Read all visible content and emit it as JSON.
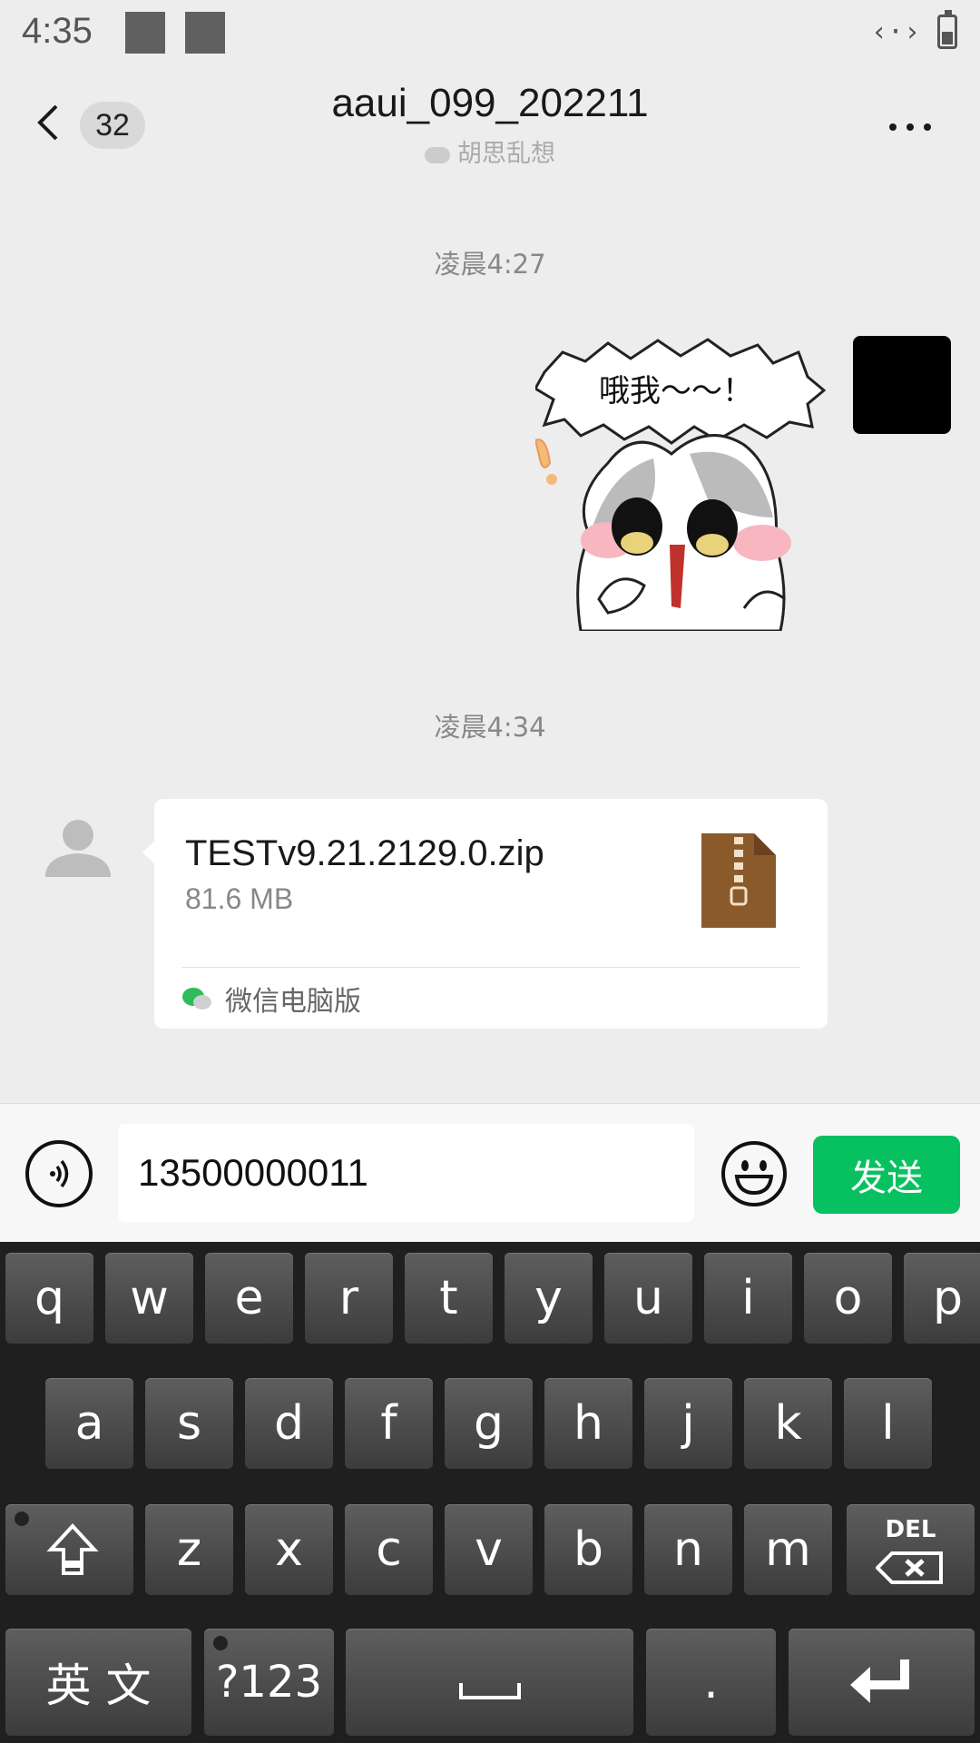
{
  "status_bar": {
    "time": "4:35"
  },
  "header": {
    "unread_count": "32",
    "title": "aaui_099_202211",
    "subtitle": "胡思乱想"
  },
  "chat": {
    "messages": [
      {
        "type": "timestamp",
        "text": "凌晨4:27"
      },
      {
        "type": "sticker",
        "sender": "me",
        "caption": "哦我～～！"
      },
      {
        "type": "timestamp",
        "text": "凌晨4:34"
      },
      {
        "type": "file",
        "sender": "other",
        "file_name": "TESTv9.21.2129.0.zip",
        "file_size": "81.6 MB",
        "source": "微信电脑版"
      }
    ]
  },
  "input_bar": {
    "text_value": "13500000011",
    "send_label": "发送"
  },
  "keyboard": {
    "row1": [
      "q",
      "w",
      "e",
      "r",
      "t",
      "y",
      "u",
      "i",
      "o",
      "p"
    ],
    "row2": [
      "a",
      "s",
      "d",
      "f",
      "g",
      "h",
      "j",
      "k",
      "l"
    ],
    "row3": [
      "z",
      "x",
      "c",
      "v",
      "b",
      "n",
      "m"
    ],
    "del_label": "DEL",
    "lang_label": "英 文",
    "symbols_label": "?123",
    "period_label": "."
  },
  "colors": {
    "send_green": "#07c160",
    "zip_brown": "#8b5a2b",
    "background": "#ededed"
  }
}
